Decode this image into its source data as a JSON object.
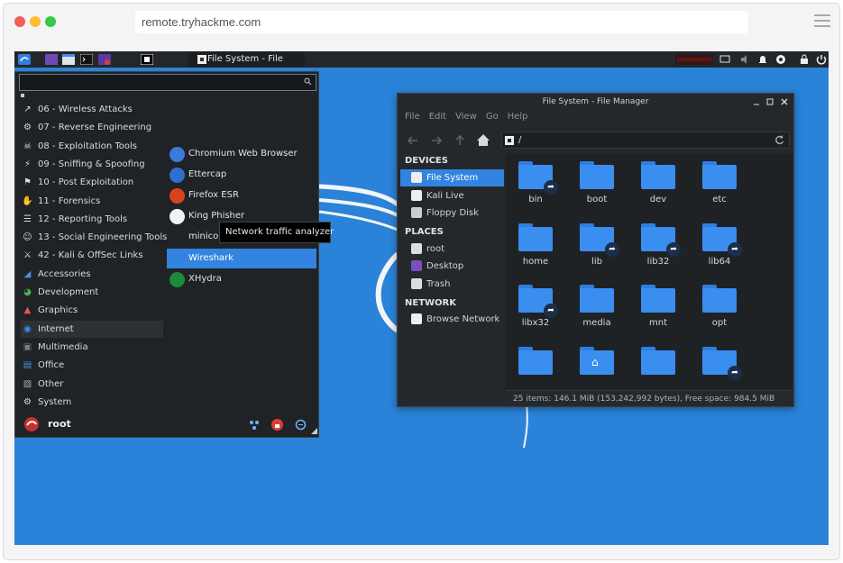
{
  "browser": {
    "url": "remote.tryhackme.com"
  },
  "panel": {
    "task_title": "File System - File Mana"
  },
  "menu": {
    "search_value": "",
    "categories": [
      {
        "label": "06 - Wireless Attacks",
        "icon": "wireless-icon"
      },
      {
        "label": "07 - Reverse Engineering",
        "icon": "reverse-engineering-icon"
      },
      {
        "label": "08 - Exploitation Tools",
        "icon": "exploitation-icon"
      },
      {
        "label": "09 - Sniffing & Spoofing",
        "icon": "sniffing-icon"
      },
      {
        "label": "10 - Post Exploitation",
        "icon": "post-exploitation-icon"
      },
      {
        "label": "11 - Forensics",
        "icon": "forensics-icon"
      },
      {
        "label": "12 - Reporting Tools",
        "icon": "reporting-icon"
      },
      {
        "label": "13 - Social Engineering Tools",
        "icon": "social-engineering-icon"
      },
      {
        "label": "42 - Kali & OffSec Links",
        "icon": "kali-links-icon"
      },
      {
        "label": "Accessories",
        "icon": "accessories-icon"
      },
      {
        "label": "Development",
        "icon": "development-icon"
      },
      {
        "label": "Graphics",
        "icon": "graphics-icon"
      },
      {
        "label": "Internet",
        "icon": "internet-icon"
      },
      {
        "label": "Multimedia",
        "icon": "multimedia-icon"
      },
      {
        "label": "Office",
        "icon": "office-icon"
      },
      {
        "label": "Other",
        "icon": "other-icon"
      },
      {
        "label": "System",
        "icon": "system-icon"
      }
    ],
    "apps": [
      {
        "label": "Chromium Web Browser",
        "icon": "chromium-icon"
      },
      {
        "label": "Ettercap",
        "icon": "ettercap-icon"
      },
      {
        "label": "Firefox ESR",
        "icon": "firefox-icon"
      },
      {
        "label": "King Phisher",
        "icon": "king-phisher-icon"
      },
      {
        "label": "minicom",
        "icon": ""
      },
      {
        "label": "Wireshark",
        "icon": "wireshark-icon"
      },
      {
        "label": "XHydra",
        "icon": "xhydra-icon"
      }
    ],
    "tooltip": "Network traffic analyzer",
    "user": "root"
  },
  "filemanager": {
    "title": "File System - File Manager",
    "menus": [
      "File",
      "Edit",
      "View",
      "Go",
      "Help"
    ],
    "path": "/",
    "sections": {
      "devices": "DEVICES",
      "places": "PLACES",
      "network": "NETWORK"
    },
    "devices": [
      "File System",
      "Kali Live",
      "Floppy Disk"
    ],
    "places": [
      "root",
      "Desktop",
      "Trash"
    ],
    "network": [
      "Browse Network"
    ],
    "folders": [
      {
        "name": "bin",
        "link": true
      },
      {
        "name": "boot",
        "link": false
      },
      {
        "name": "dev",
        "link": false
      },
      {
        "name": "etc",
        "link": false
      },
      {
        "name": "home",
        "link": false
      },
      {
        "name": "lib",
        "link": true
      },
      {
        "name": "lib32",
        "link": true
      },
      {
        "name": "lib64",
        "link": true
      },
      {
        "name": "libx32",
        "link": true
      },
      {
        "name": "media",
        "link": false
      },
      {
        "name": "mnt",
        "link": false
      },
      {
        "name": "opt",
        "link": false
      },
      {
        "name": "",
        "link": false
      },
      {
        "name": "",
        "link": false,
        "home": true
      },
      {
        "name": "",
        "link": false
      },
      {
        "name": "",
        "link": true
      }
    ],
    "status": "25 items: 146.1 MiB (153,242,992 bytes), Free space: 984.5 MiB"
  },
  "colors": {
    "desktop": "#2a83d8",
    "accent": "#3384e0",
    "folder": "#3a8ef0"
  }
}
